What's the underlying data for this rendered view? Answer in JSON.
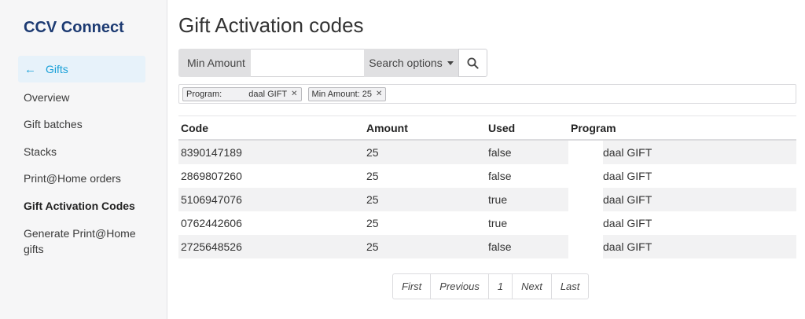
{
  "sidebar": {
    "brand": "CCV Connect",
    "back": {
      "arrow": "←",
      "label": "Gifts"
    },
    "items": [
      {
        "label": "Overview"
      },
      {
        "label": "Gift batches"
      },
      {
        "label": "Stacks"
      },
      {
        "label": "Print@Home orders"
      },
      {
        "label": "Gift Activation Codes"
      },
      {
        "label": "Generate Print@Home gifts"
      }
    ]
  },
  "main": {
    "title": "Gift Activation codes",
    "search": {
      "field_label": "Min Amount",
      "input_value": "",
      "options_label": "Search options"
    },
    "filters": [
      {
        "label": "Program:",
        "value": "daal GIFT"
      },
      {
        "label": "Min Amount: 25"
      }
    ],
    "table": {
      "headers": [
        "Code",
        "Amount",
        "Used",
        "Program"
      ],
      "rows": [
        {
          "code": "8390147189",
          "amount": "25",
          "used": "false",
          "program": "daal GIFT"
        },
        {
          "code": "2869807260",
          "amount": "25",
          "used": "false",
          "program": "daal GIFT"
        },
        {
          "code": "5106947076",
          "amount": "25",
          "used": "true",
          "program": "daal GIFT"
        },
        {
          "code": "0762442606",
          "amount": "25",
          "used": "true",
          "program": "daal GIFT"
        },
        {
          "code": "2725648526",
          "amount": "25",
          "used": "false",
          "program": "daal GIFT"
        }
      ]
    },
    "pagination": {
      "first": "First",
      "previous": "Previous",
      "page": "1",
      "next": "Next",
      "last": "Last"
    }
  }
}
